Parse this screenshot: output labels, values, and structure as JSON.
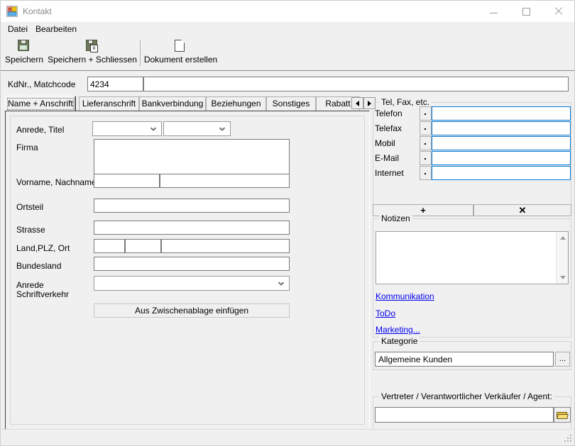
{
  "window": {
    "title": "Kontakt",
    "icon": "app-icon",
    "controls": {
      "minimize": "minimize-icon",
      "maximize": "maximize-icon",
      "close": "close-icon"
    }
  },
  "menu": {
    "items": [
      {
        "label": "Datei"
      },
      {
        "label": "Bearbeiten"
      }
    ]
  },
  "toolbar": {
    "buttons": [
      {
        "label": "Speichern",
        "icon": "floppy-disk-icon"
      },
      {
        "label": "Speichern + Schliessen",
        "icon": "floppy-disk-close-icon"
      },
      {
        "label": "Dokument erstellen",
        "icon": "document-icon"
      }
    ]
  },
  "record": {
    "label": "KdNr., Matchcode",
    "number": "4234",
    "matchcode": ""
  },
  "tabs": {
    "items": [
      {
        "label": "Name + Anschrift",
        "active": true
      },
      {
        "label": "Lieferanschrift",
        "active": false
      },
      {
        "label": "Bankverbindung",
        "active": false
      },
      {
        "label": "Beziehungen",
        "active": false
      },
      {
        "label": "Sonstiges",
        "active": false
      },
      {
        "label": "Rabatt",
        "active": false
      }
    ],
    "scroll_left": "scroll-left-icon",
    "scroll_right": "scroll-right-icon"
  },
  "form": {
    "anrede_titel_label": "Anrede, Titel",
    "anrede_value": "",
    "titel_value": "",
    "firma_label": "Firma",
    "firma_value": "",
    "name_label": "Vorname, Nachname",
    "vorname_value": "",
    "nachname_value": "",
    "ortsteil_label": "Ortsteil",
    "ortsteil_value": "",
    "strasse_label": "Strasse",
    "strasse_value": "",
    "landplzort_label": "Land,PLZ, Ort",
    "land_value": "",
    "plz_value": "",
    "ort_value": "",
    "bundesland_label": "Bundesland",
    "bundesland_value": "",
    "anrede_schriftverkehr_label_line1": "Anrede",
    "anrede_schriftverkehr_label_line2": "Schriftverkehr",
    "anrede_schriftverkehr_value": "",
    "paste_button": "Aus Zwischenablage einfügen"
  },
  "contact": {
    "group_title": "Tel, Fax, etc.",
    "rows": [
      {
        "label": "Telefon",
        "value": ""
      },
      {
        "label": "Telefax",
        "value": ""
      },
      {
        "label": "Mobil",
        "value": ""
      },
      {
        "label": "E-Mail",
        "value": ""
      },
      {
        "label": "Internet",
        "value": ""
      }
    ],
    "add_button": "+",
    "delete_button": "✕"
  },
  "notes": {
    "group_title": "Notizen",
    "value": ""
  },
  "links": [
    {
      "label": "Kommunikation"
    },
    {
      "label": "ToDo"
    },
    {
      "label": "Marketing..."
    }
  ],
  "kategorie": {
    "group_title": "Kategorie",
    "value": "Allgemeine Kunden",
    "browse_button": "..."
  },
  "vertreter": {
    "group_title": "Vertreter / Verantwortlicher Verkäufer / Agent:",
    "value": "",
    "browse_icon": "open-folder-icon"
  },
  "colors": {
    "window_bg": "#f0f0f0",
    "accent_blue": "#0a7bd4",
    "link_blue": "#0000ee",
    "title_text": "#8a8a8a"
  }
}
